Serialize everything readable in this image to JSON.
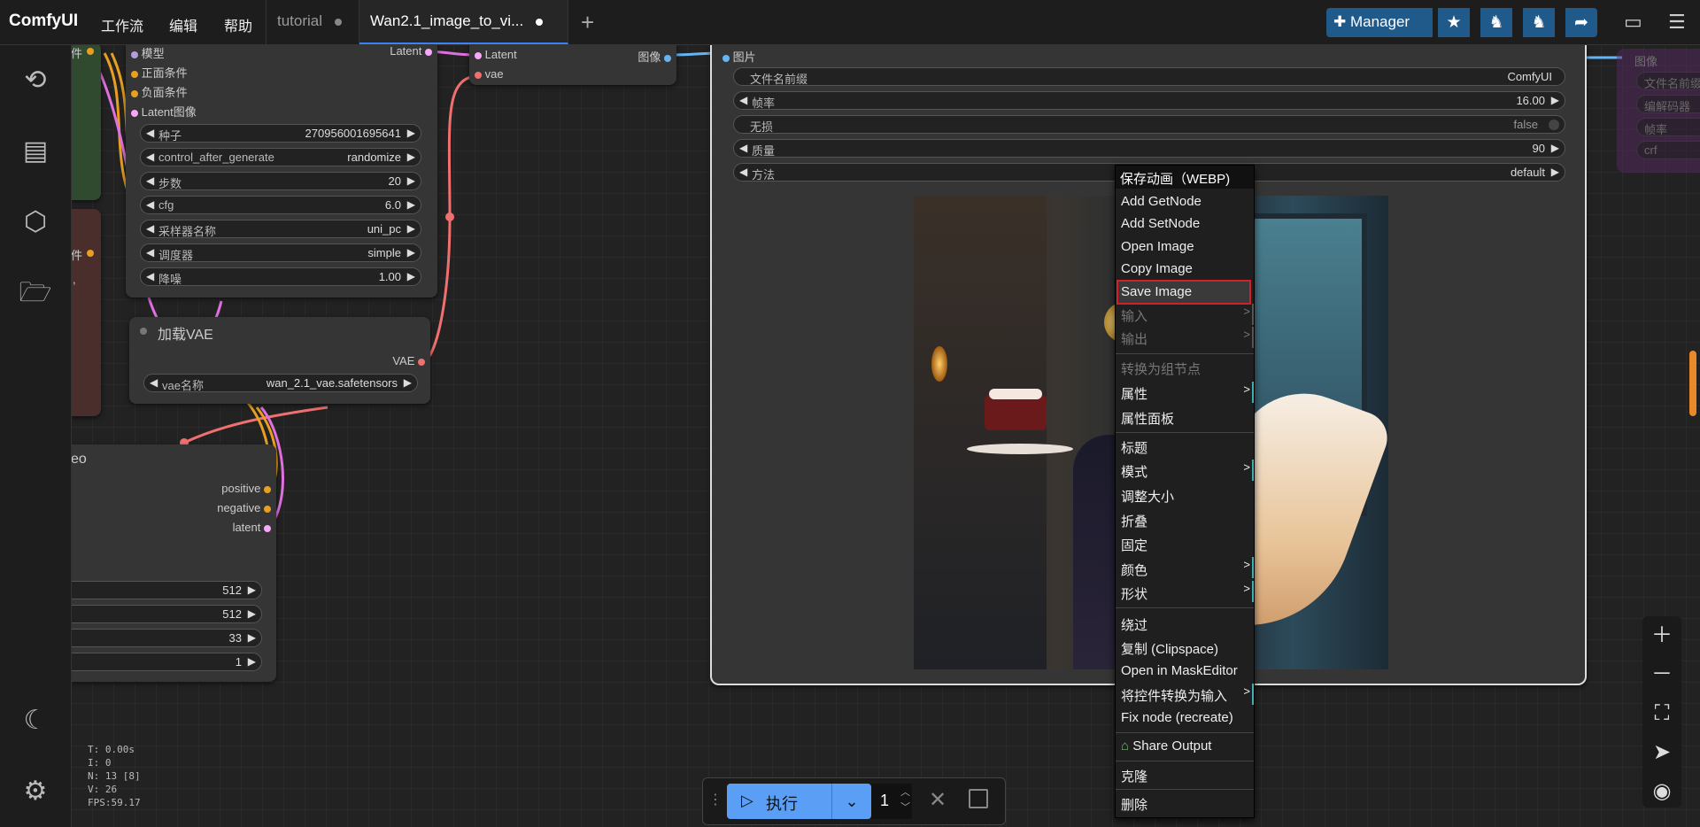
{
  "app": {
    "logo": "ComfyUI",
    "menu": [
      "工作流",
      "编辑",
      "帮助"
    ],
    "tabs": [
      {
        "label": "tutorial"
      },
      {
        "label": "Wan2.1_image_to_vi..."
      }
    ],
    "manager_label": "Manager"
  },
  "ksampler": {
    "inputs": [
      "模型",
      "正面条件",
      "负面条件",
      "Latent图像"
    ],
    "output": "Latent",
    "widgets": [
      {
        "label": "种子",
        "value": "270956001695641"
      },
      {
        "label": "control_after_generate",
        "value": "randomize"
      },
      {
        "label": "步数",
        "value": "20"
      },
      {
        "label": "cfg",
        "value": "6.0"
      },
      {
        "label": "采样器名称",
        "value": "uni_pc"
      },
      {
        "label": "调度器",
        "value": "simple"
      },
      {
        "label": "降噪",
        "value": "1.00"
      }
    ]
  },
  "left_fragments": {
    "a": "件",
    "b": "件",
    "c": ","
  },
  "vae_decode": {
    "inputs": [
      "Latent",
      "vae"
    ],
    "output": "图像"
  },
  "load_vae": {
    "title": "加载VAE",
    "output": "VAE",
    "widget_label": "vae名称",
    "widget_value": "wan_2.1_vae.safetensors"
  },
  "img2video": {
    "title_fragment": "eo",
    "outputs": [
      "positive",
      "negative",
      "latent"
    ],
    "widget_values": [
      "512",
      "512",
      "33",
      "1"
    ]
  },
  "save_webp": {
    "input": "图片",
    "widgets": [
      {
        "label": "文件名前缀",
        "value": "ComfyUI"
      },
      {
        "label": "帧率",
        "value": "16.00"
      },
      {
        "label": "无损",
        "value": "false"
      },
      {
        "label": "质量",
        "value": "90"
      },
      {
        "label": "方法",
        "value": "default"
      }
    ]
  },
  "faded_node": {
    "input": "图像",
    "widgets": [
      "文件名前缀",
      "编解码器",
      "帧率",
      "crf"
    ]
  },
  "context_menu": {
    "header": "保存动画（WEBP)",
    "items": [
      "Add GetNode",
      "Add SetNode",
      "Open Image",
      "Copy Image",
      "Save Image",
      "输入",
      "输出",
      "转换为组节点",
      "属性",
      "属性面板",
      "标题",
      "模式",
      "调整大小",
      "折叠",
      "固定",
      "颜色",
      "形状",
      "绕过",
      "复制 (Clipspace)",
      "Open in MaskEditor",
      "将控件转换为输入",
      "Fix node (recreate)",
      "Share Output",
      "克隆",
      "删除"
    ],
    "highlighted": "Save Image"
  },
  "run": {
    "label": "执行",
    "count": "1"
  },
  "stats": [
    "T: 0.00s",
    "I: 0",
    "N: 13 [8]",
    "V: 26",
    "FPS:59.17"
  ],
  "colors": {
    "accent": "#3b82f6",
    "run": "#5b9ef5",
    "highlight_border": "#d0202a"
  }
}
